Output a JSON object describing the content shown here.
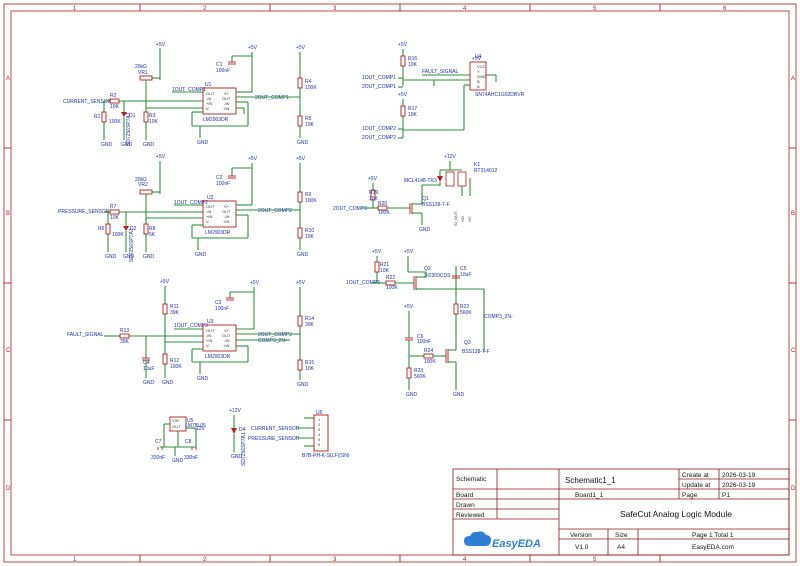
{
  "ruler": {
    "columns": [
      "1",
      "2",
      "3",
      "4",
      "5",
      "6"
    ],
    "rows": [
      "A",
      "B",
      "C",
      "D"
    ]
  },
  "title_block": {
    "schematic_label": "Schematic",
    "schematic_value": "Schematic1_1",
    "board_label": "Board",
    "board_value": "Board1_1",
    "drawn_label": "Drawn",
    "reviewed_label": "Reviewed",
    "create_label": "Create at",
    "create_value": "2026-03-19",
    "update_label": "Update at",
    "update_value": "2026-03-19",
    "page_label": "Page",
    "page_value": "P1",
    "title": "SafeCut Analog Logic Module",
    "version_label": "Version",
    "version_value": "V1.0",
    "size_label": "Size",
    "size_value": "A4",
    "page_total": "Page  1  Total  1",
    "website": "EasyEDA.com",
    "logo_text": "EasyEDA"
  },
  "power": {
    "vcc": "+5V",
    "vcc12": "+12V",
    "gnd": "GND"
  },
  "block1": {
    "sensor": "CURRENT_SENSOR",
    "pot": "20kΩ",
    "pot_ref": "VR1",
    "r2": "R2",
    "r2v": "10K",
    "r1": "R1",
    "r1v": "100K",
    "r3": "R3",
    "r3v": "10K",
    "d1": "D1",
    "d1v": "SD7256SP7A1",
    "c1": "C1",
    "c1v": "100nF",
    "u1": "U1",
    "u1v": "LM2903DR",
    "r4": "R4",
    "r4v": "100K",
    "r5": "R5",
    "r5v": "10K",
    "net_a": "1OUT_COMP1",
    "net_b": "2OUT_COMP1"
  },
  "block2": {
    "sensor": "PRESSURE_SENSOR",
    "pot": "20kΩ",
    "pot_ref": "VR2",
    "r7": "R7",
    "r7v": "10K",
    "r6": "R6",
    "r6v": "100K",
    "r8": "R8",
    "r8v": "5K",
    "d2": "D2",
    "d2v": "SD7256SP7A1",
    "c2": "C2",
    "c2v": "100nF",
    "u2": "U2",
    "u2v": "LM2903DR",
    "r9": "R9",
    "r9v": "100K",
    "r10": "R10",
    "r10v": "10K",
    "net_a": "1OUT_COMP2",
    "net_b": "2OUT_COMP2"
  },
  "block3": {
    "sensor": "FAULT_SIGNAL",
    "r13": "R13",
    "r13v": "39K",
    "r11": "R11",
    "r11v": "39K",
    "r12": "R12",
    "r12v": "100K",
    "c4": "C4",
    "c4v": "10uF",
    "c3": "C3",
    "c3v": "100nF",
    "u3": "U3",
    "u3v": "LM2903DR",
    "r14": "R14",
    "r14v": "39K",
    "r15": "R15",
    "r15v": "10K",
    "net_a": "1OUT_COMP3",
    "net_b": "2OUT_COMP3",
    "net_c": "COMP3_2N-"
  },
  "logic": {
    "u4": "U4",
    "u4v": "SN74AHC1G02DBVR",
    "fault": "FAULT_SIGNAL",
    "in1": "1OUT_COMP1",
    "in2": "2OUT_COMP1",
    "in3": "1OUT_COMP2",
    "in4": "2OUT_COMP2",
    "r16": "R16",
    "r16v": "10K",
    "r17": "R17",
    "r17v": "10K",
    "r18": "R18",
    "r18v": "10K"
  },
  "relay": {
    "drive": "2OUT_COMP3",
    "r19": "R19",
    "r19v": "10K",
    "r20": "R20",
    "r20v": "100K",
    "q1": "Q1",
    "q1v": "BSS138-7-F",
    "d3": "MCL4148-TR3",
    "k1": "K1",
    "k1v": "RT314012"
  },
  "pchan": {
    "net": "1OUT_COMP3",
    "r21": "R21",
    "r21v": "10K",
    "r22": "R22",
    "r22v": "100K",
    "q2": "Q2",
    "q2v": "SI2309CDS",
    "c5": "C5",
    "c5v": "10uF",
    "r22b": "R22",
    "r22bv": "560K",
    "net_c": "COMP3_2N-"
  },
  "timer": {
    "c6": "C6",
    "c6v": "100nF",
    "r23": "R23",
    "r23v": "560K",
    "r24": "R24",
    "r24v": "100K",
    "q3": "Q3",
    "q3v": "BSS138-7-F"
  },
  "regulator": {
    "u5": "U5",
    "u5v": "LM78L05",
    "c7": "C7",
    "c7v": "330nF",
    "c8": "C8",
    "c8v": "330nF",
    "d4": "D4",
    "d4v": "SD7256SP7A1",
    "u6": "U6",
    "u6v": "B7B-PH-K-S(LF)(SN)",
    "conn_a": "CURRENT_SENSOR",
    "conn_b": "PRESSURE_SENSOR"
  }
}
